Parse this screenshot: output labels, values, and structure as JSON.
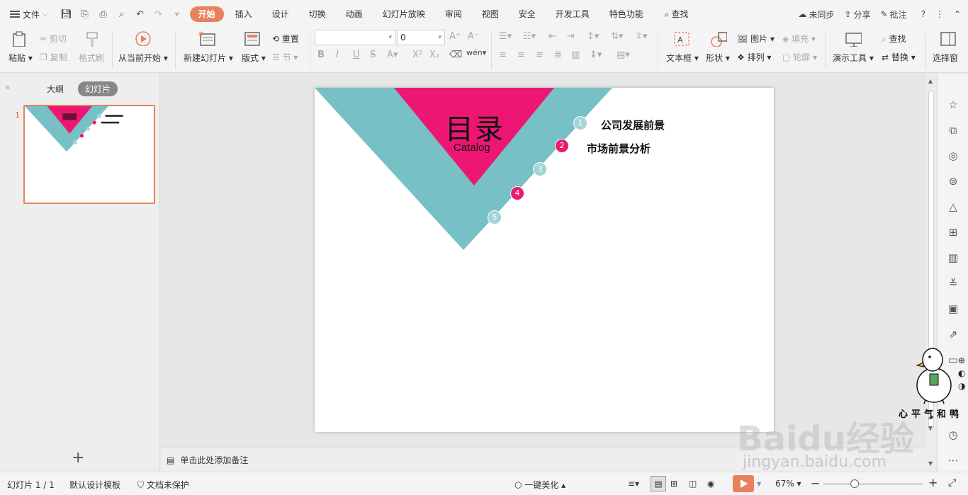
{
  "menubar": {
    "file_label": "文件",
    "tabs": [
      "开始",
      "插入",
      "设计",
      "切换",
      "动画",
      "幻灯片放映",
      "审阅",
      "视图",
      "安全",
      "开发工具",
      "特色功能"
    ],
    "search_label": "查找",
    "right": {
      "sync": "未同步",
      "share": "分享",
      "comment": "批注"
    }
  },
  "ribbon": {
    "paste": "粘贴",
    "cut": "剪切",
    "copy": "复制",
    "format_painter": "格式刷",
    "from_current": "从当前开始",
    "new_slide": "新建幻灯片",
    "layout": "版式",
    "reset": "重置",
    "section": "节",
    "font_size_value": "0",
    "textbox": "文本框",
    "shape": "形状",
    "picture": "图片",
    "fill": "填充",
    "arrange": "排列",
    "outline": "轮廓",
    "present_tools": "演示工具",
    "find": "查找",
    "replace": "替换",
    "select_pane": "选择窗"
  },
  "left_panel": {
    "tab_outline": "大纲",
    "tab_slides": "幻灯片",
    "slide_number": "1"
  },
  "slide": {
    "title": "目录",
    "subtitle": "Catalog",
    "bullets": [
      "1",
      "2",
      "3",
      "4",
      "5"
    ],
    "items": [
      "公司发展前景",
      "市场前景分析"
    ],
    "colors": {
      "teal": "#76c0c6",
      "pink": "#ee1673"
    }
  },
  "notes": {
    "placeholder": "单击此处添加备注"
  },
  "status": {
    "slide_counter": "幻灯片 1 / 1",
    "template": "默认设计模板",
    "protection": "文档未保护",
    "beautify": "一键美化",
    "zoom": "67%"
  },
  "watermark": {
    "brand": "Baidu经验",
    "url": "jingyan.baidu.com",
    "duck_caption": "心平气和鸭"
  }
}
